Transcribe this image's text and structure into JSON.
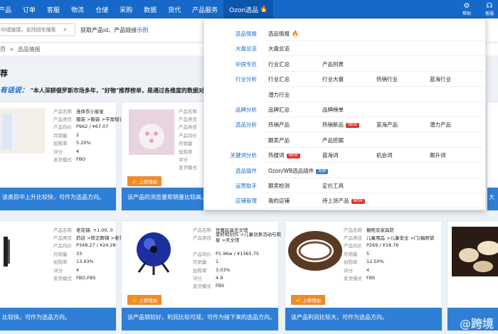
{
  "nav": {
    "items": [
      "产品",
      "订单",
      "客服",
      "物流",
      "仓储",
      "采购",
      "数据",
      "货代",
      "产品服务",
      "Ozon选品"
    ],
    "active": "Ozon选品",
    "help_label": "帮助",
    "service_label": "客服"
  },
  "search": {
    "placeholder": "ID或链接，支持回车搜索",
    "hint": "获取产品id、产品链接",
    "example_link": "示例"
  },
  "breadcrumb": [
    "页",
    "选品情报"
  ],
  "section": {
    "title": "荐",
    "slogan_lead": "有话说：",
    "slogan_text": "\"本人深耕俄罗斯市场多年，\"好物\"推荐榜单，是通过各维度的数据对"
  },
  "labels": {
    "name": "产品名称",
    "category": "产品类目",
    "price": "产品均价",
    "sales": "月销量",
    "growth": "加购率",
    "rating": "评分",
    "ship": "发货模式",
    "tag": "上榜理由"
  },
  "cards": [
    {
      "name": "连体衣小星星",
      "category": "服装 >服装 >平角短衣",
      "price": "P962 / ¥67.07",
      "sales": "2",
      "growth": "5.20%",
      "rating": "4",
      "ship": "FBO",
      "reason": "该类目中上升比较快，可作为选品方向。"
    },
    {
      "name": "",
      "category": "",
      "price": "",
      "sales": "",
      "growth": "",
      "rating": "",
      "ship": "",
      "reason": "该产品的浏览量和销量比较高，可作为选品方向。"
    },
    {
      "name": "老花镜, +1.00, 0",
      "category": "药店 >矫正眼镜 >老花镜",
      "price": "P348.27 / ¥24.28",
      "sales": "33",
      "growth": "13.93%",
      "rating": "4",
      "ship": "FBO,FBS",
      "reason": "比较快，可作为选品方向。"
    },
    {
      "name": "世嘉玩具天文馆",
      "category": "爱好和创作 >儿童创意活动与观星 >天文馆",
      "price": "P1.96w / ¥1365.75",
      "sales": "1",
      "growth": "3.03%",
      "rating": "4.9",
      "ship": "FBS",
      "reason": "该产品销较好，利润比较可观，可作为接下来的选品方向。"
    },
    {
      "name": "橱柜及家具防",
      "category": "儿童用品 >儿童安全 >门/抽屉锁",
      "price": "P269 / ¥18.76",
      "sales": "5",
      "growth": "12.50%",
      "rating": "4",
      "ship": "FBS",
      "reason": "该产品利润比较大，可作为选品方向。"
    }
  ],
  "menu": {
    "rows": [
      {
        "cat": "选品情报",
        "items": [
          {
            "t": "选品情报",
            "fire": true
          }
        ]
      },
      {
        "cat": "大盘总览",
        "items": [
          {
            "t": "大盘总览"
          }
        ]
      },
      {
        "cat": "中国专区",
        "items": [
          {
            "t": "行业汇总"
          },
          {
            "t": "产品列表"
          }
        ]
      },
      {
        "cat": "行业分析",
        "items": [
          {
            "t": "行业汇总"
          },
          {
            "t": "行业大盘"
          },
          {
            "t": "热销行业"
          },
          {
            "t": "蓝海行业"
          }
        ]
      },
      {
        "cat": "",
        "items": [
          {
            "t": "潜力行业"
          }
        ]
      },
      {
        "cat": "品牌分析",
        "items": [
          {
            "t": "品牌汇总"
          },
          {
            "t": "品牌榜单"
          }
        ]
      },
      {
        "cat": "选品分析",
        "items": [
          {
            "t": "热销产品"
          },
          {
            "t": "热销新品",
            "badge": "NEW"
          },
          {
            "t": "蓝海产品"
          },
          {
            "t": "潜力产品"
          }
        ]
      },
      {
        "cat": "",
        "items": [
          {
            "t": "跟卖产品"
          },
          {
            "t": "产品挖掘"
          }
        ]
      },
      {
        "cat": "关键词分析",
        "items": [
          {
            "t": "热搜词",
            "badge": "NEW"
          },
          {
            "t": "蓝海词"
          },
          {
            "t": "机会词"
          },
          {
            "t": "飙升词"
          }
        ]
      },
      {
        "cat": "选品插件",
        "items": [
          {
            "t": "Ozon/WB选品插件",
            "badge2": "免费"
          }
        ]
      },
      {
        "cat": "运营助手",
        "items": [
          {
            "t": "跟卖检测"
          },
          {
            "t": "定价工具"
          }
        ]
      },
      {
        "cat": "店铺管理",
        "items": [
          {
            "t": "我的店铺"
          },
          {
            "t": "待上货产品",
            "badge": "NEW"
          }
        ]
      }
    ]
  },
  "colors": {
    "brand": "#1769c9",
    "band": "#2f7fd6",
    "tag": "#f08a2c",
    "new_badge": "#e2332b"
  },
  "watermark": "@跨境"
}
